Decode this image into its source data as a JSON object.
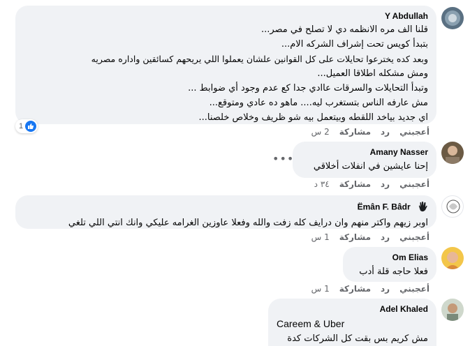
{
  "comments": [
    {
      "author": "Y Abdullah",
      "lines": [
        "قلنا الف مره الانظمه دي لا تصلح في مصر...",
        "بتبدأ كويس تحت إشراف الشركه الام...",
        "وبعد كده يخترعوا تحايلات على كل القوانين علشان يعملوا اللي يريحهم كسائقين واداره مصريه",
        "ومش مشكله اطلاقا العميل...",
        "وتبدأ التحايلات والسرقات عاادي جدا كع عدم وجود أي ضوابط ...",
        "مش عارفه الناس بتستغرب ليه.... ماهو ده عادي ومتوقع...",
        "اي جديد بياخد اللقطه وبيتعمل بيه شو ظريف وخلاص خلصنا..."
      ],
      "like": "أعجبني",
      "reply": "رد",
      "share": "مشاركة",
      "time": "2 س",
      "reaction_count": "1"
    },
    {
      "author": "Amany Nasser",
      "lines": [
        "إحنا عايشين في انفلات أخلاقي"
      ],
      "like": "أعجبني",
      "reply": "رد",
      "share": "مشاركة",
      "time": "٣٤ د"
    },
    {
      "author": "Ëmân F. Bâdr",
      "lines": [
        "اوبر زيهم واكتر منهم وان درايف كله زفت والله وفعلا عاوزين الغرامه عليكي وانك انتي اللي تلغي"
      ],
      "like": "أعجبني",
      "reply": "رد",
      "share": "مشاركة",
      "time": "1 س"
    },
    {
      "author": "Om Elias",
      "lines": [
        "فعلا حاجه قلة أدب"
      ],
      "like": "أعجبني",
      "reply": "رد",
      "share": "مشاركة",
      "time": "1 س"
    },
    {
      "author": "Adel Khaled",
      "lines": [
        "Careem & Uber",
        "مش كريم بس بقت كل الشركات كدة"
      ]
    }
  ],
  "colors": {
    "bubble": "#f0f2f5",
    "meta": "#65676b",
    "like_blue": "#1877f2"
  }
}
